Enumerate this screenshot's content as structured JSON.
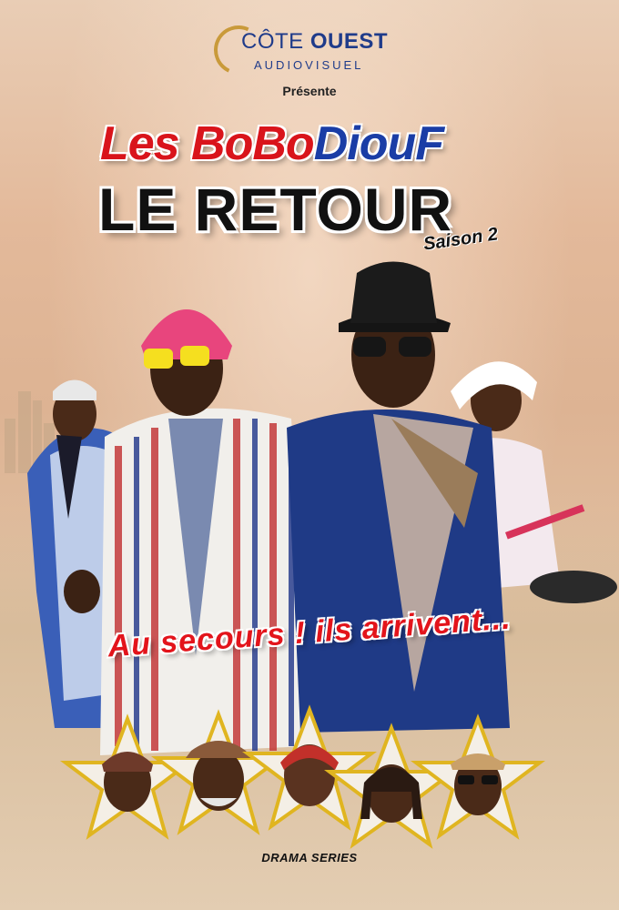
{
  "logo": {
    "word1": "CÔTE",
    "word2": "OUEST",
    "sub": "AUDIOVISUEL",
    "color_primary": "#1f3b8a",
    "color_arc": "#c99a3a"
  },
  "presente": "Présente",
  "title": {
    "line1_part1": "Les BoBo",
    "line1_part2": "DiouF",
    "line2": "LE RETOUR",
    "season": "Saison 2",
    "color_red": "#d9141b",
    "color_blue": "#1a3da6"
  },
  "tagline": "Au secours ! ils arrivent...",
  "footer": "DRAMA SERIES",
  "cast_stars": [
    {
      "icon": "star-portrait-woman-headwrap"
    },
    {
      "icon": "star-portrait-man-hat"
    },
    {
      "icon": "star-portrait-woman-red-hair"
    },
    {
      "icon": "star-portrait-woman-braids"
    },
    {
      "icon": "star-portrait-man-sunglasses"
    }
  ],
  "figures": [
    {
      "icon": "man-white-boubou-figure"
    },
    {
      "icon": "man-striped-jacket-figure"
    },
    {
      "icon": "man-blue-jacket-figure"
    },
    {
      "icon": "woman-white-dress-figure"
    }
  ]
}
